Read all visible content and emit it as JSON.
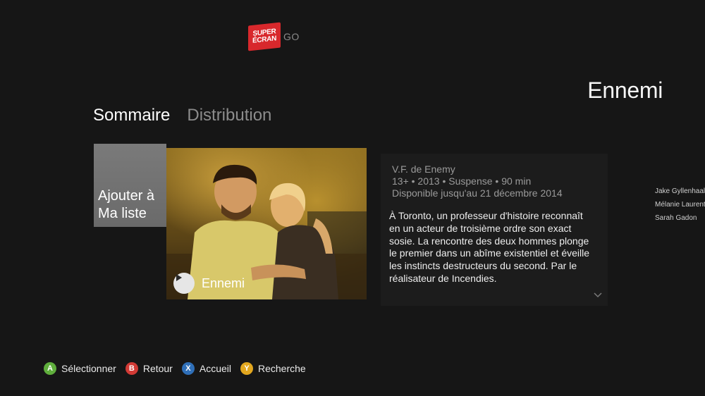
{
  "brand": {
    "line1": "SUPER",
    "line2": "ÉCRAN",
    "suffix": "GO",
    "color": "#d8282c"
  },
  "movie": {
    "title": "Ennemi"
  },
  "tabs": [
    {
      "label": "Sommaire",
      "active": true
    },
    {
      "label": "Distribution",
      "active": false
    }
  ],
  "add_tile": {
    "line1": "Ajouter à",
    "line2": "Ma liste"
  },
  "poster": {
    "play_icon": "play-icon",
    "play_label": "Ennemi"
  },
  "details": {
    "original_title": "V.F. de Enemy",
    "info": "13+ • 2013 • Suspense • 90 min",
    "availability": "Disponible jusqu'au 21 décembre  2014",
    "synopsis": "À Toronto, un professeur d'histoire reconnaît en un acteur de troisième ordre son exact sosie. La rencontre des deux hommes plonge le premier dans un abîme existentiel et éveille les instincts destructeurs du second. Par le réalisateur de Incendies.",
    "more_icon": "chevron-down-icon"
  },
  "cast": [
    "Jake Gyllenhaal",
    "Mélanie Laurent",
    "Sarah Gadon"
  ],
  "controls": [
    {
      "key": "A",
      "label": "Sélectionner",
      "color": "#5fae3c"
    },
    {
      "key": "B",
      "label": "Retour",
      "color": "#d23a35"
    },
    {
      "key": "X",
      "label": "Accueil",
      "color": "#2f6fb8"
    },
    {
      "key": "Y",
      "label": "Recherche",
      "color": "#e2a71f"
    }
  ]
}
